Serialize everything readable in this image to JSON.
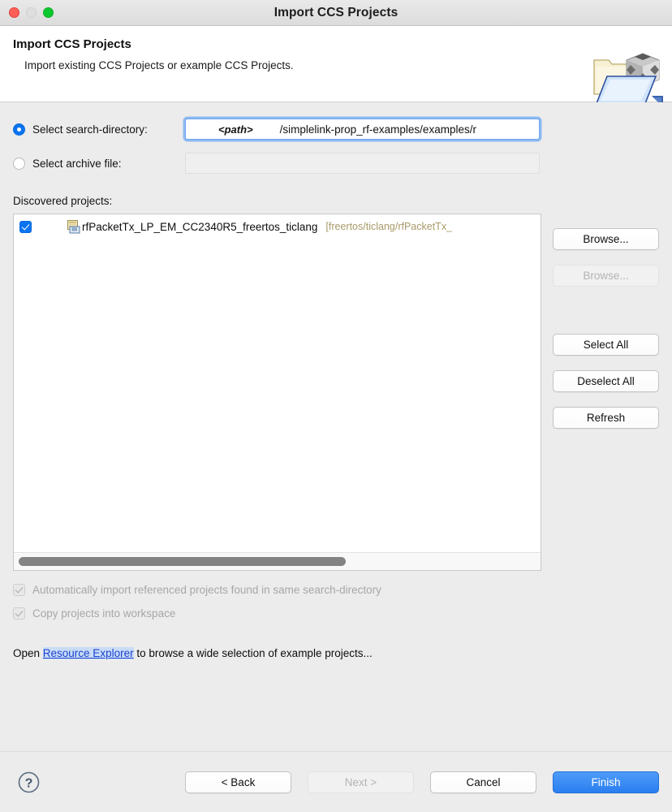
{
  "window": {
    "title": "Import CCS Projects",
    "traffic_lights": [
      "close-red",
      "minimize-gray",
      "maximize-green"
    ]
  },
  "header": {
    "title": "Import CCS Projects",
    "subtitle": "Import existing CCS Projects or example CCS Projects.",
    "icon": "import-projects-folder-icon"
  },
  "source": {
    "search_directory": {
      "label": "Select search-directory:",
      "selected": true,
      "path_token": "<path>",
      "path_rest": "/simplelink-prop_rf-examples/examples/r",
      "browse_label": "Browse...",
      "browse_enabled": true
    },
    "archive_file": {
      "label": "Select archive file:",
      "selected": false,
      "value": "",
      "browse_label": "Browse...",
      "browse_enabled": false
    }
  },
  "discovered": {
    "label": "Discovered projects:",
    "projects": [
      {
        "checked": true,
        "name": "rfPacketTx_LP_EM_CC2340R5_freertos_ticlang",
        "path": "[freertos/ticlang/rfPacketTx_",
        "icon": "ccs-project-icon"
      }
    ],
    "buttons": {
      "select_all": "Select All",
      "deselect_all": "Deselect All",
      "refresh": "Refresh"
    },
    "scrollbar": {
      "orientation": "horizontal",
      "thumb_fraction": 0.62
    }
  },
  "options": [
    {
      "label": "Automatically import referenced projects found in same search-directory",
      "checked": true,
      "enabled": false
    },
    {
      "label": "Copy projects into workspace",
      "checked": true,
      "enabled": false
    }
  ],
  "open_line": {
    "prefix": "Open ",
    "link": "Resource Explorer",
    "suffix": " to browse a wide selection of example projects..."
  },
  "footer": {
    "help_icon": "help-question-icon",
    "back": "< Back",
    "next": "Next >",
    "next_enabled": false,
    "cancel": "Cancel",
    "finish": "Finish"
  },
  "colors": {
    "accent": "#0a74f0",
    "primary_button": "#2a7ef0",
    "link": "#1c43d0",
    "project_path": "#a99a69",
    "disabled_text": "#a7a7a7",
    "window_bg": "#ececec"
  }
}
